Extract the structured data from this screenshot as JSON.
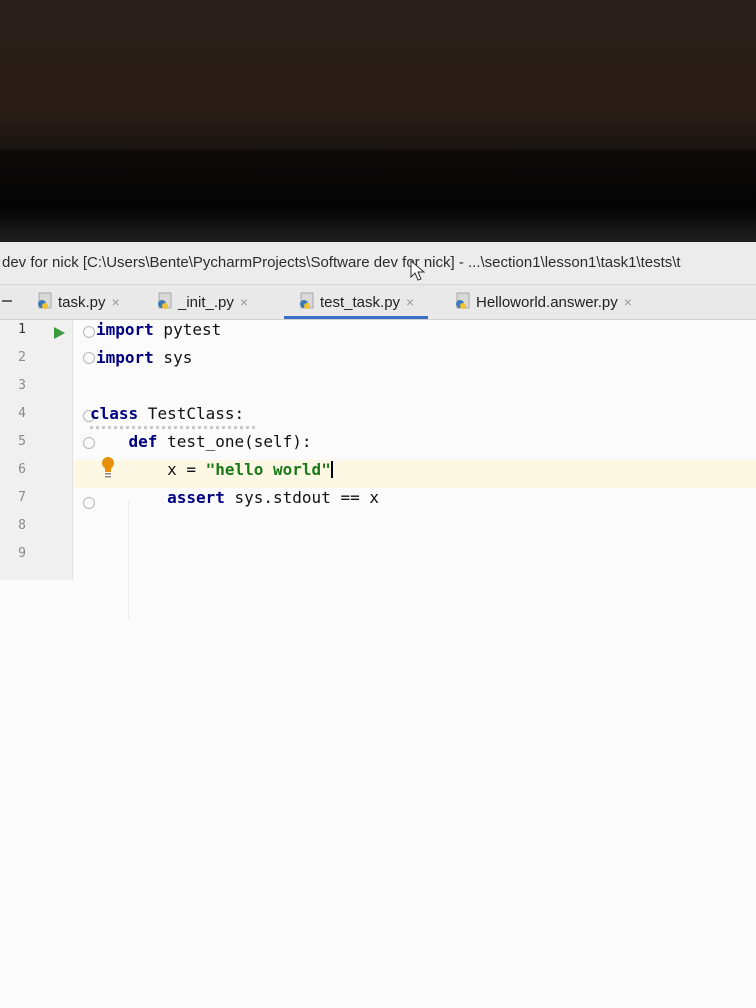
{
  "window": {
    "title": "dev for nick [C:\\Users\\Bente\\PycharmProjects\\Software dev for nick] - ...\\section1\\lesson1\\task1\\tests\\t"
  },
  "tabs": [
    {
      "label": "task.py",
      "close": "×",
      "active": false
    },
    {
      "label": "_init_.py",
      "close": "×",
      "active": false
    },
    {
      "label": "test_task.py",
      "close": "×",
      "active": true
    },
    {
      "label": "Helloworld.answer.py",
      "close": "×",
      "active": false
    }
  ],
  "editor": {
    "line_numbers": [
      "1",
      "2",
      "3",
      "4",
      "5",
      "6",
      "7",
      "8",
      "9"
    ],
    "lines": [
      {
        "kw": "import",
        "rest": " pytest"
      },
      {
        "kw": "import",
        "rest": " sys"
      },
      {
        "text": ""
      },
      {
        "kw": "class",
        "rest": " TestClass:"
      },
      {
        "indent": "    ",
        "kw": "def",
        "rest": " test_one(self):"
      },
      {
        "indent": "        ",
        "pre": "x = ",
        "str": "\"hello world\""
      },
      {
        "indent": "        ",
        "kw": "assert",
        "rest": " sys.stdout == x"
      }
    ]
  },
  "colors": {
    "keyword": "#000080",
    "string": "#1a7a1a",
    "active_tab_underline": "#3a6fc9",
    "current_line": "#fdf8e4",
    "run_arrow": "#3c9a3c",
    "bulb": "#e8900c"
  },
  "icons": [
    "python-file-icon",
    "close-icon",
    "run-icon",
    "fold-icon",
    "lightbulb-icon",
    "mouse-cursor-icon"
  ]
}
